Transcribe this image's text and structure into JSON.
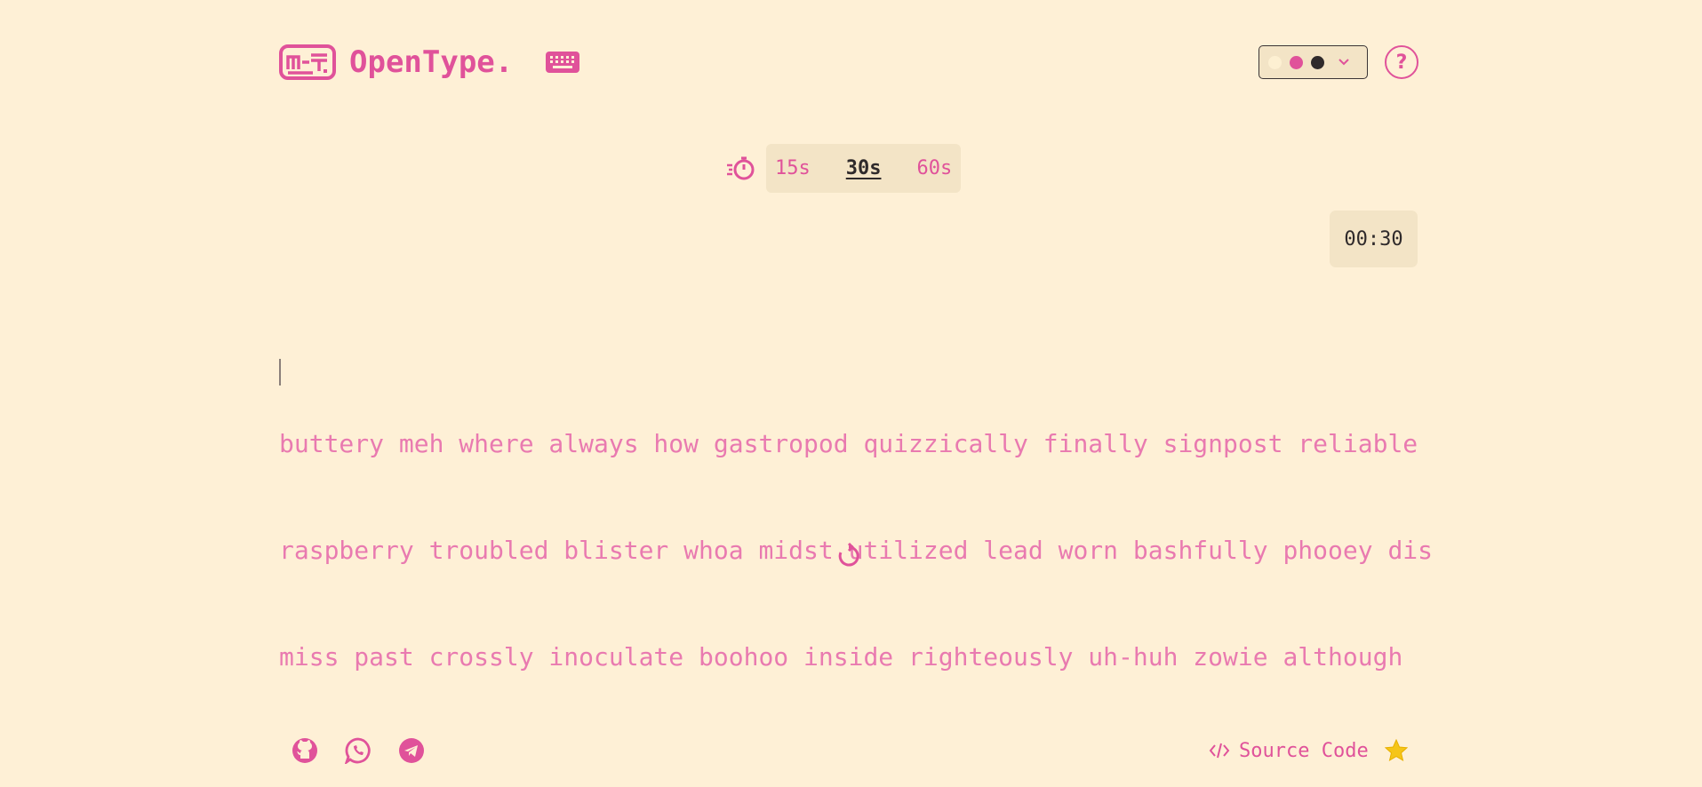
{
  "header": {
    "brand": "OpenType.",
    "logo_icon": "keyboard-logo-icon",
    "keyboard_icon": "keyboard-icon",
    "help_label": "?",
    "theme_swatches": [
      "#fdf0d2",
      "#e0529a",
      "#2f2a2b"
    ]
  },
  "timer": {
    "icon": "stopwatch-icon",
    "options": [
      {
        "label": "15s",
        "active": false
      },
      {
        "label": "30s",
        "active": true
      },
      {
        "label": "60s",
        "active": false
      }
    ],
    "countdown": "00:30"
  },
  "words": {
    "lines": [
      "buttery meh where always how gastropod quizzically finally signpost reliable",
      "raspberry troubled blister whoa midst utilized lead worn bashfully phooey dis",
      "miss past crossly inoculate boohoo inside righteously uh-huh zowie although"
    ]
  },
  "footer": {
    "socials": [
      "github-icon",
      "whatsapp-icon",
      "telegram-icon"
    ],
    "source_label": "Source Code",
    "star_icon": "star-icon"
  },
  "colors": {
    "background": "#fef0d6",
    "accent": "#e0529a",
    "text_dark": "#2f2a2b",
    "panel": "#f3e4c6"
  }
}
